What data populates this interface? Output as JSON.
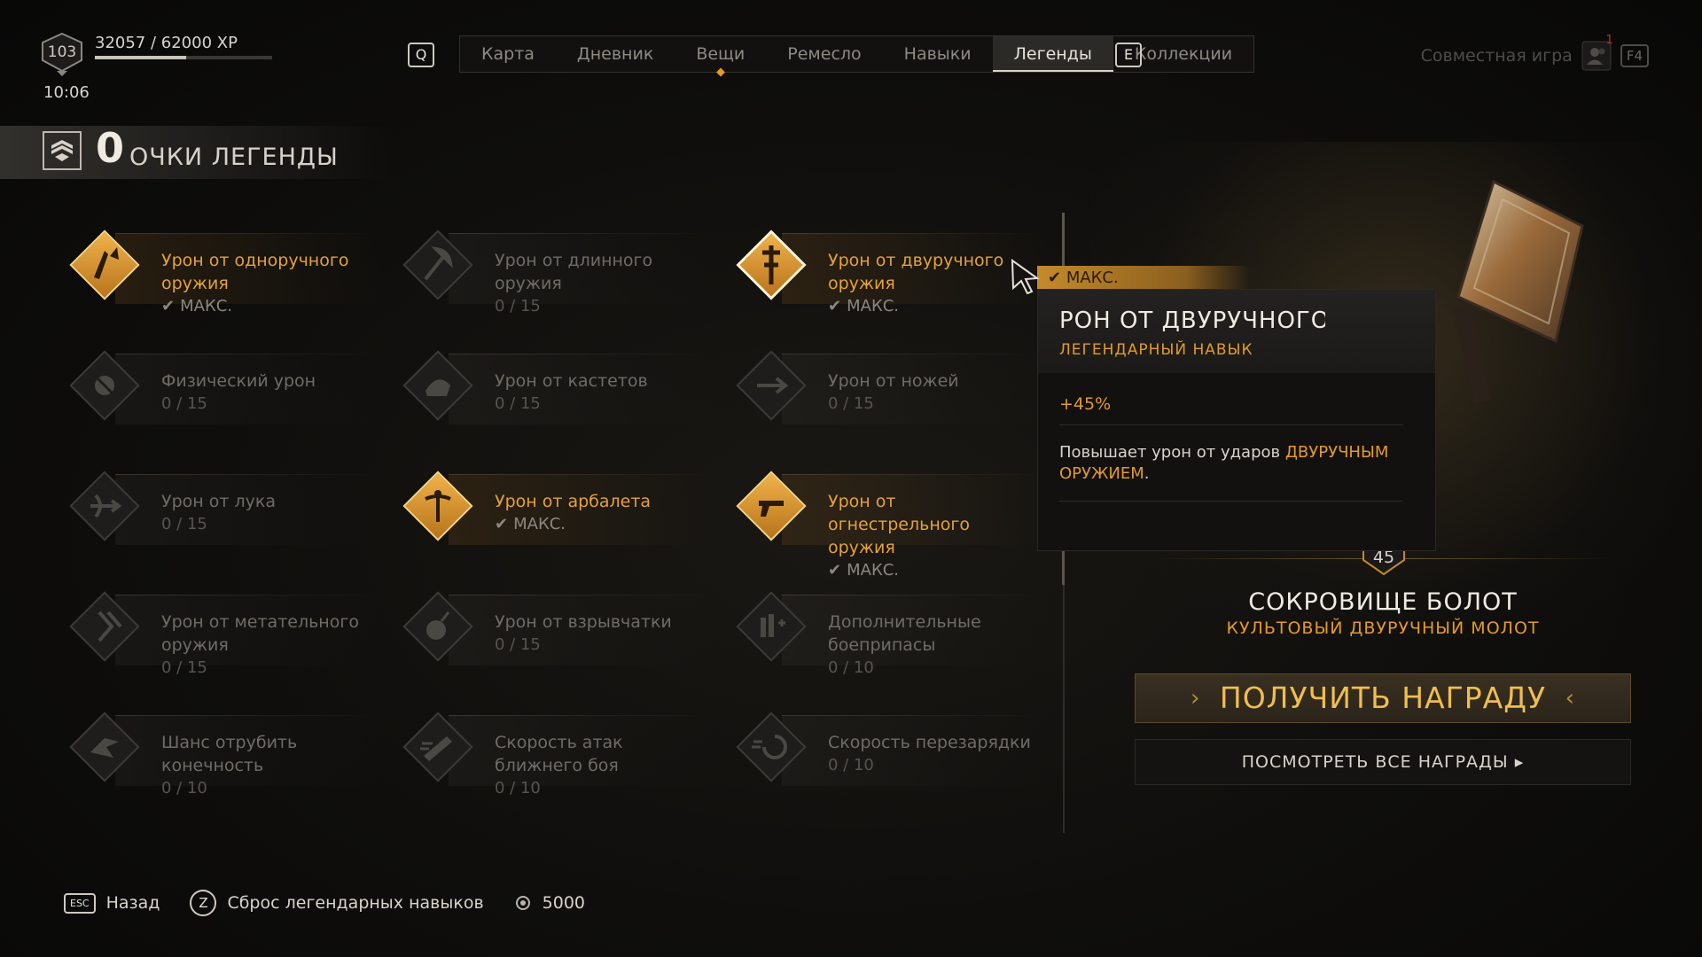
{
  "player": {
    "level": "103",
    "xp_text": "32057 / 62000 XP",
    "xp_progress": 0.517,
    "time": "10:06"
  },
  "nav": {
    "left_key": "Q",
    "right_key": "E",
    "tabs": [
      {
        "label": "Карта"
      },
      {
        "label": "Дневник"
      },
      {
        "label": "Вещи",
        "notify": true
      },
      {
        "label": "Ремесло"
      },
      {
        "label": "Навыки"
      },
      {
        "label": "Легенды",
        "active": true
      },
      {
        "label": "Коллекции"
      }
    ]
  },
  "coop": {
    "label": "Совместная игра",
    "badge": "1",
    "key": "F4"
  },
  "legend_points": {
    "count": "0",
    "label": "ОЧКИ ЛЕГЕНДЫ"
  },
  "skills": [
    {
      "name": "Урон от одноручного оружия",
      "progress": "МАКС.",
      "maxed": true,
      "icon": "one-handed-icon"
    },
    {
      "name": "Урон от длинного оружия",
      "progress": "0 / 15",
      "maxed": false,
      "icon": "long-weapon-icon"
    },
    {
      "name": "Урон от двуручного оружия",
      "progress": "МАКС.",
      "maxed": true,
      "selected": true,
      "icon": "two-handed-icon"
    },
    {
      "name": "Физический урон",
      "progress": "0 / 15",
      "maxed": false,
      "icon": "physical-icon"
    },
    {
      "name": "Урон от кастетов",
      "progress": "0 / 15",
      "maxed": false,
      "icon": "knuckles-icon"
    },
    {
      "name": "Урон от ножей",
      "progress": "0 / 15",
      "maxed": false,
      "icon": "knives-icon"
    },
    {
      "name": "Урон от лука",
      "progress": "0 / 15",
      "maxed": false,
      "icon": "bow-icon"
    },
    {
      "name": "Урон от арбалета",
      "progress": "МАКС.",
      "maxed": true,
      "icon": "crossbow-icon"
    },
    {
      "name": "Урон от огнестрельного оружия",
      "progress": "МАКС.",
      "maxed": true,
      "icon": "firearm-icon"
    },
    {
      "name": "Урон от метательного оружия",
      "progress": "0 / 15",
      "maxed": false,
      "icon": "throwing-icon"
    },
    {
      "name": "Урон от взрывчатки",
      "progress": "0 / 15",
      "maxed": false,
      "icon": "explosives-icon"
    },
    {
      "name": "Дополнительные боеприпасы",
      "progress": "0 / 10",
      "maxed": false,
      "icon": "ammo-icon"
    },
    {
      "name": "Шанс отрубить конечность",
      "progress": "0 / 10",
      "maxed": false,
      "icon": "dismember-icon"
    },
    {
      "name": "Скорость атак ближнего боя",
      "progress": "0 / 10",
      "maxed": false,
      "icon": "melee-speed-icon"
    },
    {
      "name": "Скорость перезарядки",
      "progress": "0 / 10",
      "maxed": false,
      "icon": "reload-icon"
    }
  ],
  "tooltip": {
    "max_label": "МАКС.",
    "title": "РОН ОТ ДВУРУЧНОГО С",
    "subtitle": "ЛЕГЕНДАРНЫЙ НАВЫК",
    "value": "+45%",
    "desc_prefix": "Повышает урон от ударов ",
    "desc_highlight": "ДВУРУЧНЫМ ОРУЖИЕМ",
    "desc_suffix": "."
  },
  "reward": {
    "level": "45",
    "name": "СОКРОВИЩЕ БОЛОТ",
    "type": "КУЛЬТОВЫЙ ДВУРУЧНЫЙ МОЛОТ",
    "claim_label": "ПОЛУЧИТЬ НАГРАДУ",
    "view_all_label": "ПОСМОТРЕТЬ ВСЕ НАГРАДЫ ▸"
  },
  "footer": {
    "back_key": "ESC",
    "back_label": "Назад",
    "reset_key": "Z",
    "reset_label": "Сброс легендарных навыков",
    "cost": "5000"
  },
  "colors": {
    "accent": "#e39a2a",
    "gold": "#f0b24a",
    "text": "#d8d4cc"
  }
}
